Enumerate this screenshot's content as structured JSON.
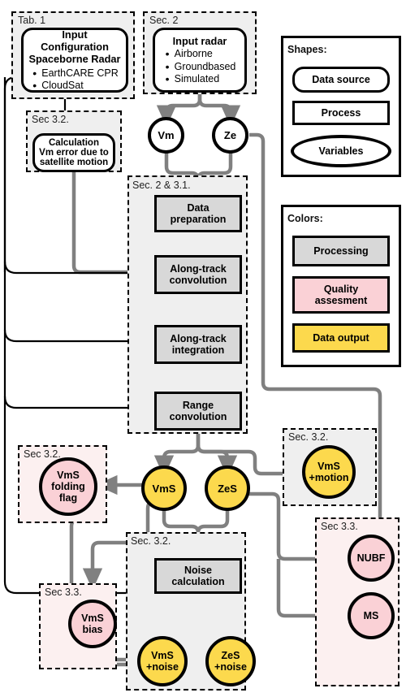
{
  "groups": [
    {
      "id": "tab1",
      "label": "Tab. 1"
    },
    {
      "id": "sec2",
      "label": "Sec. 2"
    },
    {
      "id": "sec32a",
      "label": "Sec 3.2."
    },
    {
      "id": "sec2_31",
      "label": "Sec. 2 & 3.1."
    },
    {
      "id": "sec32motion",
      "label": "Sec. 3.2."
    },
    {
      "id": "sec32fold",
      "label": "Sec 3.2."
    },
    {
      "id": "sec32noise",
      "label": "Sec. 3.2."
    },
    {
      "id": "sec33bias",
      "label": "Sec 3.3."
    },
    {
      "id": "sec33qa",
      "label": "Sec 3.3."
    }
  ],
  "nodes": {
    "input_config": {
      "title_line1": "Input Configuration",
      "title_line2": "Spaceborne Radar",
      "bullets": [
        "EarthCARE CPR",
        "CloudSat"
      ]
    },
    "input_radar": {
      "title_line1": "Input radar",
      "bullets": [
        "Airborne",
        "Groundbased",
        "Simulated"
      ]
    },
    "calculation": {
      "line1": "Calculation",
      "line2": "Vm error due to",
      "line3": "satellite motion"
    },
    "vm": "Vm",
    "ze": "Ze",
    "data_preparation": {
      "line1": "Data",
      "line2": "preparation"
    },
    "along_track_convolution": {
      "line1": "Along-track",
      "line2": "convolution"
    },
    "along_track_integration": {
      "line1": "Along-track",
      "line2": "integration"
    },
    "range_convolution": {
      "line1": "Range",
      "line2": "convolution"
    },
    "vms": "VmS",
    "zes": "ZeS",
    "vms_motion": {
      "line1": "VmS",
      "line2": "+motion"
    },
    "vms_folding_flag": {
      "line1": "VmS",
      "line2": "folding",
      "line3": "flag"
    },
    "noise_calculation": {
      "line1": "Noise",
      "line2": "calculation"
    },
    "vms_noise": {
      "line1": "VmS",
      "line2": "+noise"
    },
    "zes_noise": {
      "line1": "ZeS",
      "line2": "+noise"
    },
    "vms_bias": {
      "line1": "VmS",
      "line2": "bias"
    },
    "nubf": "NUBF",
    "ms": "MS"
  },
  "legend_shapes": {
    "title": "Shapes:",
    "items": [
      {
        "key": "data-source",
        "label": "Data source",
        "shape": "rounded"
      },
      {
        "key": "process",
        "label": "Process",
        "shape": "rectangle"
      },
      {
        "key": "variables",
        "label": "Variables",
        "shape": "ellipse"
      }
    ]
  },
  "legend_colors": {
    "title": "Colors:",
    "items": [
      {
        "key": "processing",
        "label": "Processing",
        "color": "#d8d8d8"
      },
      {
        "key": "quality-assesment",
        "label_line1": "Quality",
        "label_line2": "assesment",
        "color": "#fad1d6"
      },
      {
        "key": "data-output",
        "label": "Data output",
        "color": "#fcd94d"
      }
    ]
  },
  "colors": {
    "processing_fill": "#d8d8d8",
    "quality_fill": "#fad1d6",
    "data_output_fill": "#fcd94d",
    "group_gray": "#efefef",
    "group_pink": "#fcf0f0",
    "gray_arrow": "#808080",
    "black_arrow": "#000000",
    "outline": "#000000"
  }
}
